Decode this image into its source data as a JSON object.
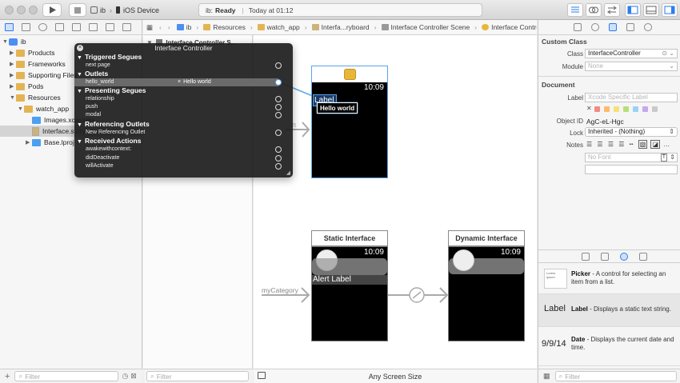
{
  "toolbar": {
    "scheme_target": "ib",
    "scheme_device": "iOS Device",
    "status_app": "ib:",
    "status_state": "Ready",
    "status_time": "Today at 01:12"
  },
  "navigator": {
    "items": [
      {
        "label": "ib",
        "level": 0,
        "kind": "project",
        "expanded": true
      },
      {
        "label": "Products",
        "level": 1,
        "kind": "folder",
        "expanded": false
      },
      {
        "label": "Frameworks",
        "level": 1,
        "kind": "folder",
        "expanded": false
      },
      {
        "label": "Supporting Files",
        "level": 1,
        "kind": "folder",
        "expanded": false
      },
      {
        "label": "Pods",
        "level": 1,
        "kind": "folder",
        "expanded": false
      },
      {
        "label": "Resources",
        "level": 1,
        "kind": "folder",
        "expanded": true
      },
      {
        "label": "watch_app",
        "level": 2,
        "kind": "folder",
        "expanded": true
      },
      {
        "label": "Images.xcassets",
        "level": 3,
        "kind": "assets"
      },
      {
        "label": "Interface.storyboard",
        "level": 3,
        "kind": "ib",
        "selected": true
      },
      {
        "label": "Base.lproj",
        "level": 3,
        "kind": "blue-folder",
        "expanded": false
      }
    ],
    "filter_placeholder": "Filter"
  },
  "outline": {
    "top_item": "Interface Controller S...",
    "filter_placeholder": "Filter"
  },
  "jump_bar": {
    "crumbs": [
      "ib",
      "Resources",
      "watch_app",
      "Interfa...ryboard",
      "Interface Controller Scene",
      "Interface Controller"
    ]
  },
  "popover": {
    "title": "Interface Controller",
    "sections": [
      {
        "title": "Triggered Segues",
        "rows": [
          {
            "label": "next page",
            "filled": false
          }
        ]
      },
      {
        "title": "Outlets",
        "rows": [
          {
            "label": "hello_world",
            "target": "Hello world",
            "filled": true
          }
        ]
      },
      {
        "title": "Presenting Segues",
        "rows": [
          {
            "label": "relationship",
            "filled": false
          },
          {
            "label": "push",
            "filled": false
          },
          {
            "label": "modal",
            "filled": false
          }
        ]
      },
      {
        "title": "Referencing Outlets",
        "rows": [
          {
            "label": "New Referencing Outlet",
            "filled": false
          }
        ]
      },
      {
        "title": "Received Actions",
        "rows": [
          {
            "label": "awakewithcontext:",
            "filled": false
          },
          {
            "label": "didDeactivate",
            "filled": false
          },
          {
            "label": "willActivate",
            "filled": false
          }
        ]
      }
    ]
  },
  "canvas": {
    "main_scene": {
      "clock": "10:09",
      "label_text": "Label",
      "tooltip": "Hello world"
    },
    "static_scene": {
      "title": "Static Interface",
      "clock": "10:09",
      "alert_label": "Alert Label",
      "segue_label": "myCategory"
    },
    "dynamic_scene": {
      "title": "Dynamic Interface",
      "clock": "10:09"
    },
    "partial_segue_label": "n",
    "size_class": "Any Screen Size"
  },
  "inspector": {
    "custom_class": {
      "header": "Custom Class",
      "class_label": "Class",
      "class_value": "InterfaceController",
      "module_label": "Module",
      "module_placeholder": "None"
    },
    "document": {
      "header": "Document",
      "label_label": "Label",
      "label_placeholder": "Xcode Specific Label",
      "object_id_label": "Object ID",
      "object_id_value": "AgC-eL-Hgc",
      "lock_label": "Lock",
      "lock_value": "Inherited - (Nothing)",
      "notes_label": "Notes",
      "font_placeholder": "No Font",
      "label_colors": [
        "#f28b82",
        "#fbbc6a",
        "#f7e07a",
        "#b5e07a",
        "#9ad2f7",
        "#c4a8f0",
        "#c9c9c9"
      ]
    },
    "library": [
      {
        "name": "Picker",
        "desc": " - A control for selecting an item from a list.",
        "thumb": "Lorem ipsum"
      },
      {
        "name": "Label",
        "desc": " - Displays a static text string.",
        "thumb": "Label"
      },
      {
        "name": "Date",
        "desc": " - Displays the current date and time.",
        "thumb": "9/9/14"
      }
    ],
    "filter_placeholder": "Filter"
  }
}
